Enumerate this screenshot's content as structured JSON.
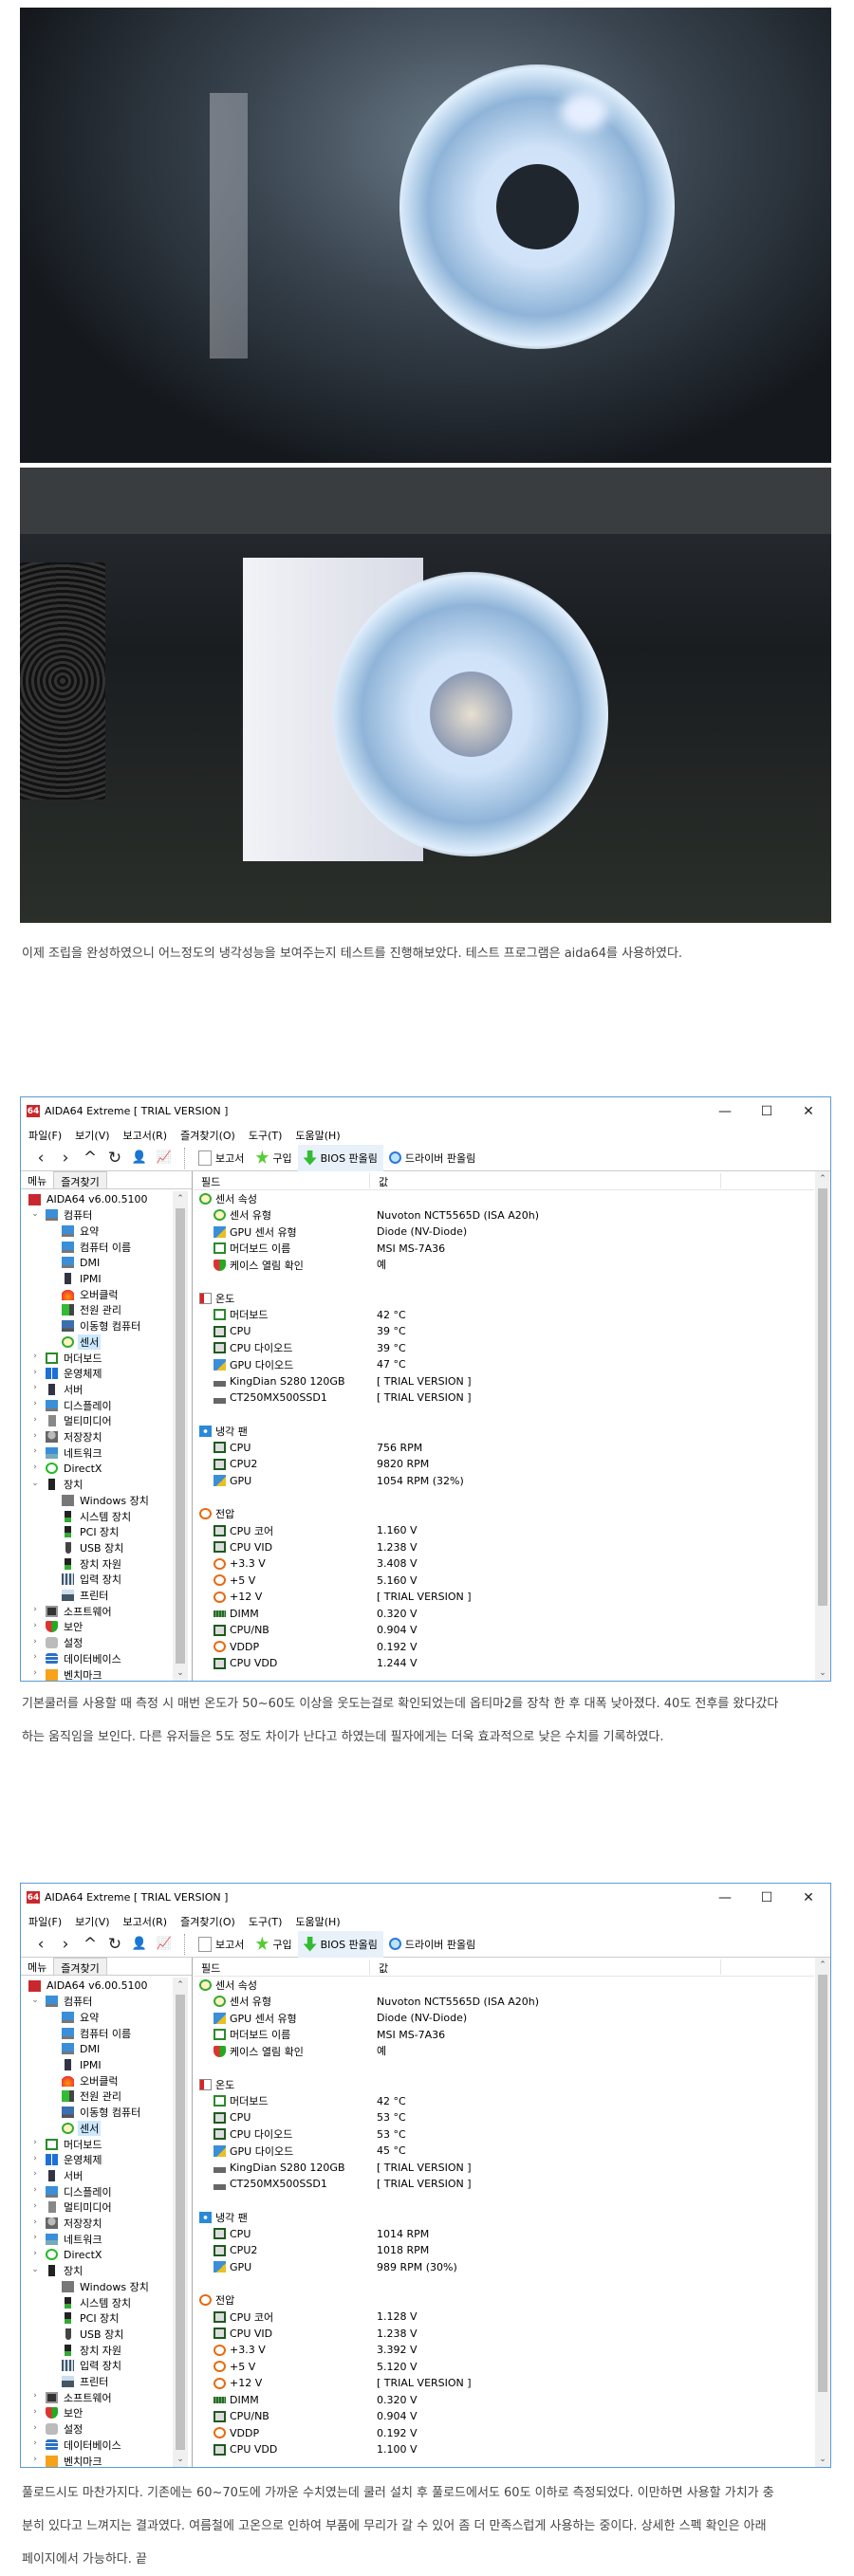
{
  "article": {
    "para1": "이제 조립을 완성하였으니 어느정도의 냉각성능을 보여주는지 테스트를 진행해보았다. 테스트 프로그램은 aida64를 사용하였다.",
    "para2_line1": "기본쿨러를 사용할 때 측정 시 매번 온도가 50~60도 이상을 웃도는걸로 확인되었는데 옵티마2를 장착 한 후 대폭 낮아졌다. 40도 전후를 왔다갔다",
    "para2_line2": "하는 움직임을 보인다. 다른 유저들은 5도 정도 차이가 난다고 하였는데 필자에게는 더욱 효과적으로 낮은 수치를 기록하였다.",
    "para3_line1": "풀로드시도 마찬가지다. 기존에는 60~70도에 가까운 수치였는데 쿨러 설치 후 풀로드에서도 60도 이하로 측정되었다. 이만하면 사용할 가치가 충",
    "para3_line2": "분히 있다고 느껴지는 결과였다. 여름철에 고온으로 인하여 부품에 무리가 갈 수 있어 좀 더 만족스럽게 사용하는 중이다. 상세한 스펙 확인은 아래",
    "para3_line3": "페이지에서 가능하다. 끝"
  },
  "aida": {
    "logo": "64",
    "title": "AIDA64 Extreme  [ TRIAL VERSION ]",
    "window_controls": {
      "minimize": "—",
      "maximize": "☐",
      "close": "✕"
    },
    "menu": [
      "파일(F)",
      "보기(V)",
      "보고서(R)",
      "즐겨찾기(O)",
      "도구(T)",
      "도움말(H)"
    ],
    "nav_icons": [
      {
        "name": "back-icon",
        "glyph": "‹"
      },
      {
        "name": "forward-icon",
        "glyph": "›"
      },
      {
        "name": "up-icon",
        "glyph": "^"
      },
      {
        "name": "refresh-icon",
        "glyph": "↻"
      },
      {
        "name": "user-icon",
        "glyph": "👤"
      },
      {
        "name": "chart-icon",
        "glyph": "📈"
      }
    ],
    "toolbar": {
      "report": "보고서",
      "buy": "구입",
      "bios": "BIOS 판올림",
      "driver": "드라이버 판올림"
    },
    "tabs": {
      "menu": "메뉴",
      "favorites": "즐겨찾기"
    },
    "headers": {
      "field": "필드",
      "value": "값"
    },
    "tree": [
      {
        "label": "AIDA64 v6.00.5100",
        "level": 0,
        "icon": "aida"
      },
      {
        "label": "컴퓨터",
        "level": 1,
        "icon": "monitor",
        "chev": "down"
      },
      {
        "label": "요약",
        "level": 2,
        "icon": "monitor"
      },
      {
        "label": "컴퓨터 이름",
        "level": 2,
        "icon": "monitor"
      },
      {
        "label": "DMI",
        "level": 2,
        "icon": "monitor"
      },
      {
        "label": "IPMI",
        "level": 2,
        "icon": "server"
      },
      {
        "label": "오버클럭",
        "level": 2,
        "icon": "fire"
      },
      {
        "label": "전원 관리",
        "level": 2,
        "icon": "power"
      },
      {
        "label": "이동형 컴퓨터",
        "level": 2,
        "icon": "laptop"
      },
      {
        "label": "센서",
        "level": 2,
        "icon": "sensor",
        "selected": true
      },
      {
        "label": "머더보드",
        "level": 1,
        "icon": "board",
        "chev": "right"
      },
      {
        "label": "운영체제",
        "level": 1,
        "icon": "windows",
        "chev": "right"
      },
      {
        "label": "서버",
        "level": 1,
        "icon": "server",
        "chev": "right"
      },
      {
        "label": "디스플레이",
        "level": 1,
        "icon": "monitor",
        "chev": "right"
      },
      {
        "label": "멀티미디어",
        "level": 1,
        "icon": "multimedia",
        "chev": "right"
      },
      {
        "label": "저장장치",
        "level": 1,
        "icon": "storage",
        "chev": "right"
      },
      {
        "label": "네트워크",
        "level": 1,
        "icon": "network",
        "chev": "right"
      },
      {
        "label": "DirectX",
        "level": 1,
        "icon": "directx",
        "chev": "right"
      },
      {
        "label": "장치",
        "level": 1,
        "icon": "device",
        "chev": "down"
      },
      {
        "label": "Windows 장치",
        "level": 2,
        "icon": "winnet"
      },
      {
        "label": "시스템 장치",
        "level": 2,
        "icon": "devgreen"
      },
      {
        "label": "PCI 장치",
        "level": 2,
        "icon": "devgreen"
      },
      {
        "label": "USB 장치",
        "level": 2,
        "icon": "usb"
      },
      {
        "label": "장치 자원",
        "level": 2,
        "icon": "devgreen"
      },
      {
        "label": "입력 장치",
        "level": 2,
        "icon": "keyboard"
      },
      {
        "label": "프린터",
        "level": 2,
        "icon": "printer"
      },
      {
        "label": "소프트웨어",
        "level": 1,
        "icon": "software",
        "chev": "right"
      },
      {
        "label": "보안",
        "level": 1,
        "icon": "shield",
        "chev": "right"
      },
      {
        "label": "설정",
        "level": 1,
        "icon": "settings",
        "chev": "right"
      },
      {
        "label": "데이터베이스",
        "level": 1,
        "icon": "database",
        "chev": "right"
      },
      {
        "label": "벤치마크",
        "level": 1,
        "icon": "bench",
        "chev": "right"
      }
    ],
    "fields": [
      {
        "label": "센서 속성",
        "group": true,
        "icon": "sensor"
      },
      {
        "label": "센서 유형",
        "icon": "sensor"
      },
      {
        "label": "GPU 센서 유형",
        "icon": "gpu"
      },
      {
        "label": "머더보드 이름",
        "icon": "board"
      },
      {
        "label": "케이스 열림 확인",
        "icon": "shield"
      },
      {
        "blank": true
      },
      {
        "label": "온도",
        "group": true,
        "icon": "thermo"
      },
      {
        "label": "머더보드",
        "icon": "board"
      },
      {
        "label": "CPU",
        "icon": "cpu"
      },
      {
        "label": "CPU 다이오드",
        "icon": "cpu"
      },
      {
        "label": "GPU 다이오드",
        "icon": "gpu"
      },
      {
        "label": "KingDian S280 120GB",
        "icon": "drive"
      },
      {
        "label": "CT250MX500SSD1",
        "icon": "drive"
      },
      {
        "blank": true
      },
      {
        "label": "냉각 팬",
        "group": true,
        "icon": "fan"
      },
      {
        "label": "CPU",
        "icon": "cpu"
      },
      {
        "label": "CPU2",
        "icon": "cpu"
      },
      {
        "label": "GPU",
        "icon": "gpu"
      },
      {
        "blank": true
      },
      {
        "label": "전압",
        "group": true,
        "icon": "volt"
      },
      {
        "label": "CPU 코어",
        "icon": "cpu"
      },
      {
        "label": "CPU VID",
        "icon": "cpu"
      },
      {
        "label": "+3.3 V",
        "icon": "volt"
      },
      {
        "label": "+5 V",
        "icon": "volt"
      },
      {
        "label": "+12 V",
        "icon": "volt"
      },
      {
        "label": "DIMM",
        "icon": "dimm"
      },
      {
        "label": "CPU/NB",
        "icon": "cpu"
      },
      {
        "label": "VDDP",
        "icon": "volt"
      },
      {
        "label": "CPU VDD",
        "icon": "cpu"
      }
    ]
  },
  "windows": [
    {
      "values": [
        "",
        "Nuvoton NCT5565D  (ISA A20h)",
        "Diode  (NV-Diode)",
        "MSI MS-7A36",
        "예",
        "",
        "",
        "42 °C",
        "39 °C",
        "39 °C",
        "47 °C",
        "[ TRIAL VERSION ]",
        "[ TRIAL VERSION ]",
        "",
        "",
        "756 RPM",
        "9820 RPM",
        "1054 RPM  (32%)",
        "",
        "",
        "1.160 V",
        "1.238 V",
        "3.408 V",
        "5.160 V",
        "[ TRIAL VERSION ]",
        "0.320 V",
        "0.904 V",
        "0.192 V",
        "1.244 V"
      ]
    },
    {
      "values": [
        "",
        "Nuvoton NCT5565D  (ISA A20h)",
        "Diode  (NV-Diode)",
        "MSI MS-7A36",
        "예",
        "",
        "",
        "42 °C",
        "53 °C",
        "53 °C",
        "45 °C",
        "[ TRIAL VERSION ]",
        "[ TRIAL VERSION ]",
        "",
        "",
        "1014 RPM",
        "1018 RPM",
        "989 RPM  (30%)",
        "",
        "",
        "1.128 V",
        "1.238 V",
        "3.392 V",
        "5.120 V",
        "[ TRIAL VERSION ]",
        "0.320 V",
        "0.904 V",
        "0.192 V",
        "1.100 V"
      ]
    }
  ],
  "colors": {
    "accent": "#5b9bd5",
    "logo": "#c8282d",
    "selection": "#cce8ff"
  }
}
